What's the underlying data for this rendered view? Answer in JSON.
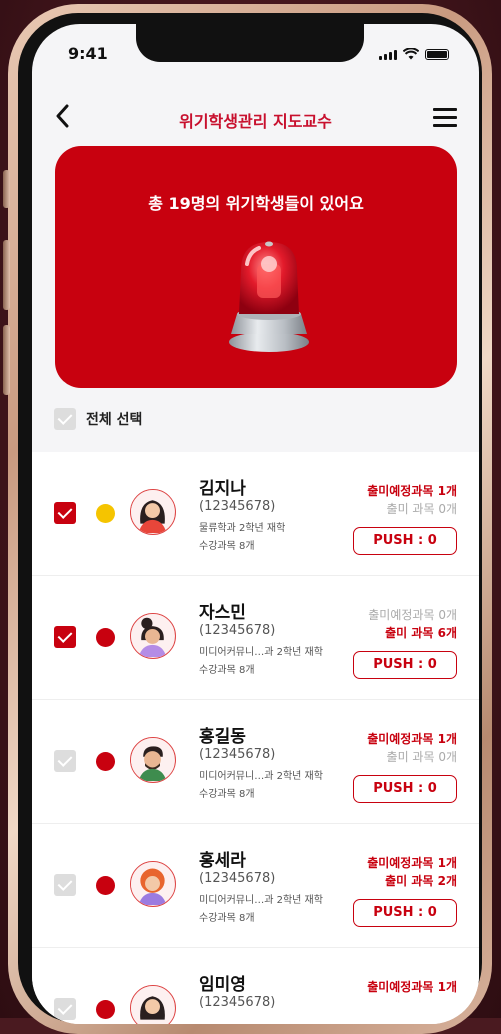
{
  "status_bar": {
    "time": "9:41"
  },
  "header": {
    "title": "위기학생관리 지도교수"
  },
  "banner": {
    "message": "총 19명의 위기학생들이 있어요"
  },
  "select_all": {
    "label": "전체 선택",
    "checked": false
  },
  "students": [
    {
      "name": "김지나",
      "id": "(12345678)",
      "dept": "물류학과 2학년 재학",
      "courses": "수강과목 8개",
      "stat1": "출미예정과목 1개",
      "stat1_style": "red",
      "stat2": "출미 과목 0개",
      "stat2_style": "gray",
      "push": "PUSH : 0",
      "checked": true,
      "dot_color": "#f5c400",
      "avatar": "female-long-hair"
    },
    {
      "name": "자스민",
      "id": "(12345678)",
      "dept": "미디어커뮤니…과 2학년 재학",
      "courses": "수강과목 8개",
      "stat1": "출미예정과목 0개",
      "stat1_style": "gray",
      "stat2": "출미 과목 6개",
      "stat2_style": "red",
      "push": "PUSH : 0",
      "checked": true,
      "dot_color": "#c8010f",
      "avatar": "female-bun"
    },
    {
      "name": "홍길동",
      "id": "(12345678)",
      "dept": "미디어커뮤니…과 2학년 재학",
      "courses": "수강과목 8개",
      "stat1": "출미예정과목 1개",
      "stat1_style": "red",
      "stat2": "출미 과목 0개",
      "stat2_style": "gray",
      "push": "PUSH : 0",
      "checked": false,
      "dot_color": "#c8010f",
      "avatar": "male-beard"
    },
    {
      "name": "홍세라",
      "id": "(12345678)",
      "dept": "미디어커뮤니…과 2학년 재학",
      "courses": "수강과목 8개",
      "stat1": "출미예정과목 1개",
      "stat1_style": "red",
      "stat2": "출미 과목 2개",
      "stat2_style": "red",
      "push": "PUSH : 0",
      "checked": false,
      "dot_color": "#c8010f",
      "avatar": "female-curly"
    },
    {
      "name": "임미영",
      "id": "(12345678)",
      "dept": "",
      "courses": "",
      "stat1": "출미예정과목 1개",
      "stat1_style": "red",
      "stat2": "",
      "stat2_style": "gray",
      "push": "",
      "checked": false,
      "dot_color": "#c8010f",
      "avatar": "female-long-hair"
    }
  ]
}
